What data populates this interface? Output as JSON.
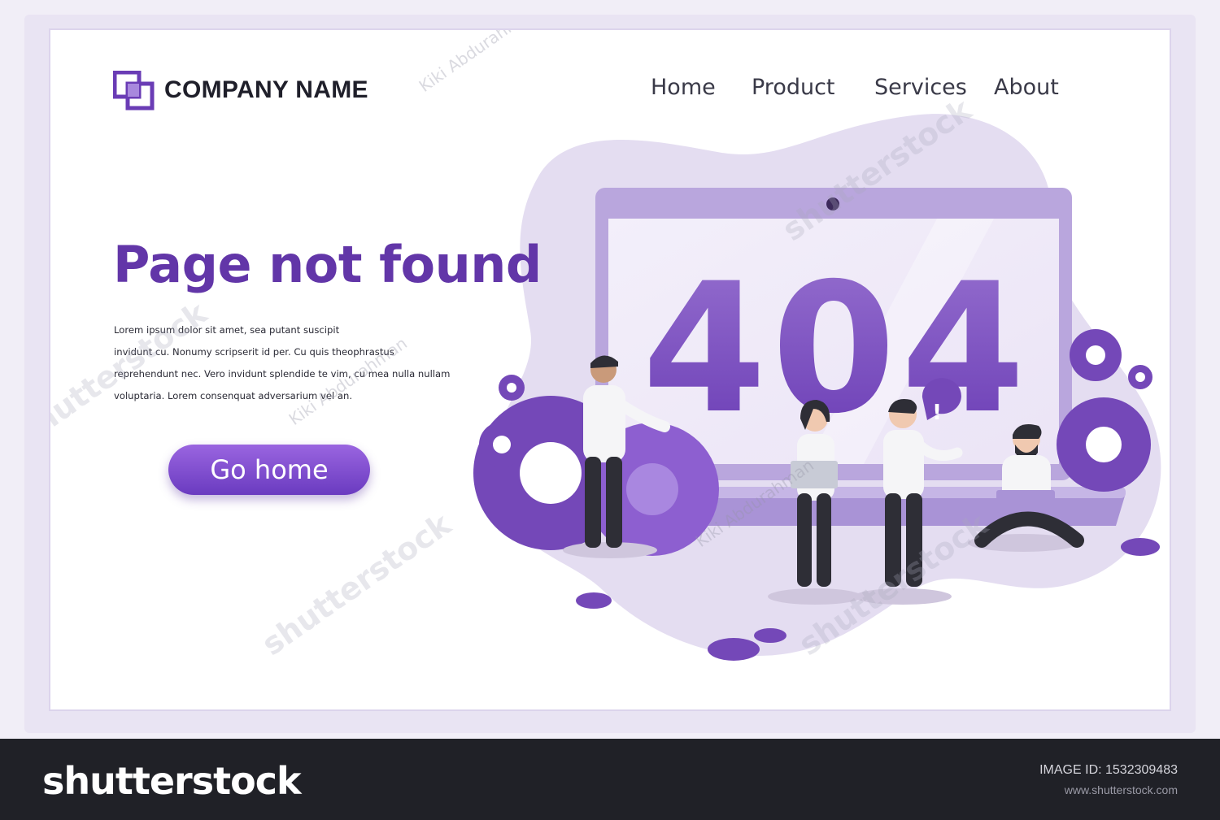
{
  "header": {
    "company_name": "COMPANY NAME",
    "nav": [
      {
        "label": "Home"
      },
      {
        "label": "Product"
      },
      {
        "label": "Services"
      },
      {
        "label": "About"
      }
    ]
  },
  "hero": {
    "title": "Page not found",
    "body_lines": [
      "Lorem ipsum dolor sit amet, sea putant suscipit",
      "invidunt cu. Nonumy scripserit id per. Cu quis theophrastus",
      "reprehendunt nec. Vero invidunt splendide te vim, cu mea nulla nullam",
      "voluptaria. Lorem consenquat adversarium vel an."
    ],
    "button_label": "Go home"
  },
  "illustration": {
    "error_code": "404",
    "alert_symbol": "!",
    "icons": [
      "laptop-icon",
      "gear-icon",
      "person-icon",
      "speech-bubble-icon"
    ]
  },
  "watermark": {
    "brand": "shutterstock",
    "author": "Kiki Abdurahman"
  },
  "footer": {
    "brand": "shutterstock",
    "image_id": "IMAGE ID: 1532309483",
    "url": "www.shutterstock.com"
  },
  "colors": {
    "accent": "#6236a8",
    "button_top": "#9a65e0",
    "button_bottom": "#6a3bc0",
    "blob": "#e4ddf1",
    "laptop": "#b9a6dd",
    "gear": "#7448b8",
    "footer_bg": "#202127"
  }
}
